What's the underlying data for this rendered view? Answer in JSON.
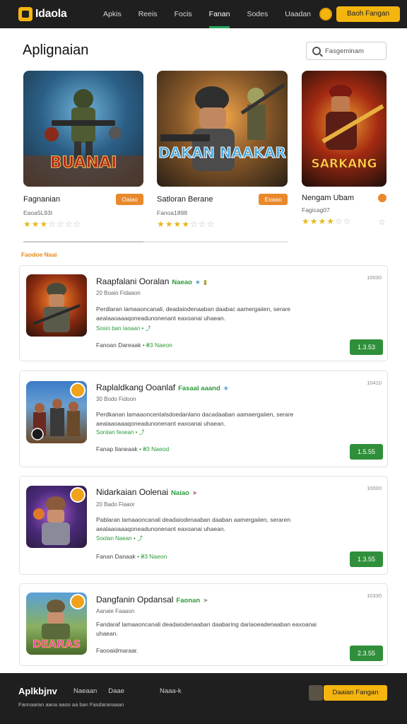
{
  "topbar": {
    "logo_text": "Idaola",
    "nav": [
      "Apkis",
      "Reeis",
      "Focis",
      "Fanan",
      "Sodes",
      "Uaadan"
    ],
    "active_index": 3,
    "cta_label": "Baoh Fangan"
  },
  "header": {
    "title": "Aplignaian",
    "search_placeholder": "Fasgeminam"
  },
  "featured": [
    {
      "art_text": "BUANAI",
      "title": "Fagnanian",
      "badge": "Oaiao",
      "sub": "Eaoa5L93I",
      "stars": 3
    },
    {
      "art_text": "DAKAN NAAKAR",
      "title": "Satloran Berane",
      "badge": "Eoaao",
      "sub": "Fanoa1898",
      "stars": 3
    },
    {
      "art_text": "SARKANG",
      "title": "Nengam Ubam",
      "badge": "",
      "sub": "Fagicag07",
      "stars": 4
    }
  ],
  "section_label": "Faodoe Naai",
  "cards": [
    {
      "title": "Raapfalani Ooralan",
      "tag": "Naeao",
      "date": "10030",
      "meta": "20 Boaio Fidaaon",
      "desc": "Perdlaran lamaaoncanali, deadaiodenaaban daabac aamergaiien, serare aealaaoaaaqoneadunonenant eaxoanai uhaean.",
      "link": "Sosio ban Iaoaan • ⤴",
      "foot_label": "Fanoan Dareaak",
      "foot_value": "• ₴3 Naeon",
      "button": "1.3.53"
    },
    {
      "title": "Raplaldkang Ooanlaf",
      "tag": "Fasaal aaand",
      "date": "10410",
      "meta": "30 Bodo Fidoon",
      "desc": "Perdkanan lamaaoncentalsdoedanlano dacadaaban aamaergaiien, serare aealaaoaaaqoneadunonenant eaxoanai uhaean.",
      "link": "Soniian feoean • ⤴",
      "foot_label": "Fanap Ilaneaak",
      "foot_value": "• ₴3 Naeod",
      "button": "1.5.55"
    },
    {
      "title": "Nidarkaian Oolenai",
      "tag": "Naiao",
      "date": "10000",
      "meta": "20 Bado Fiaaor",
      "desc": "Pablaran lamaaoncanali deadaiodenaaban daaban aamergaiien, seraren aealaaoaaaqoneadunonenant eaxoanai uhaean.",
      "link": "Soolan Naean • ⤴",
      "foot_label": "Fanan Danaak",
      "foot_value": "• ₴3 Naeon",
      "button": "1.3.55"
    },
    {
      "title": "Dangfanin Opdansal",
      "tag": "Faonan",
      "date": "10330",
      "meta": "Aanaie Faaaon",
      "desc": "Fandaraf lamaaoncanali deadaiodenaaban daabaring dariaoeadenaaban eaxoanai uhaean.",
      "link": "",
      "foot_label": "Faooaidmaraar.",
      "foot_value": "",
      "button": "2.3.55"
    }
  ],
  "footer": {
    "brand": "Aplkbjnv",
    "links": [
      "Naeaan",
      "Daae",
      "Naaa-k"
    ],
    "note": "Fannaaran aana aaoo aa ban Fasdaranaaan",
    "button": "Daaian Fangan"
  }
}
